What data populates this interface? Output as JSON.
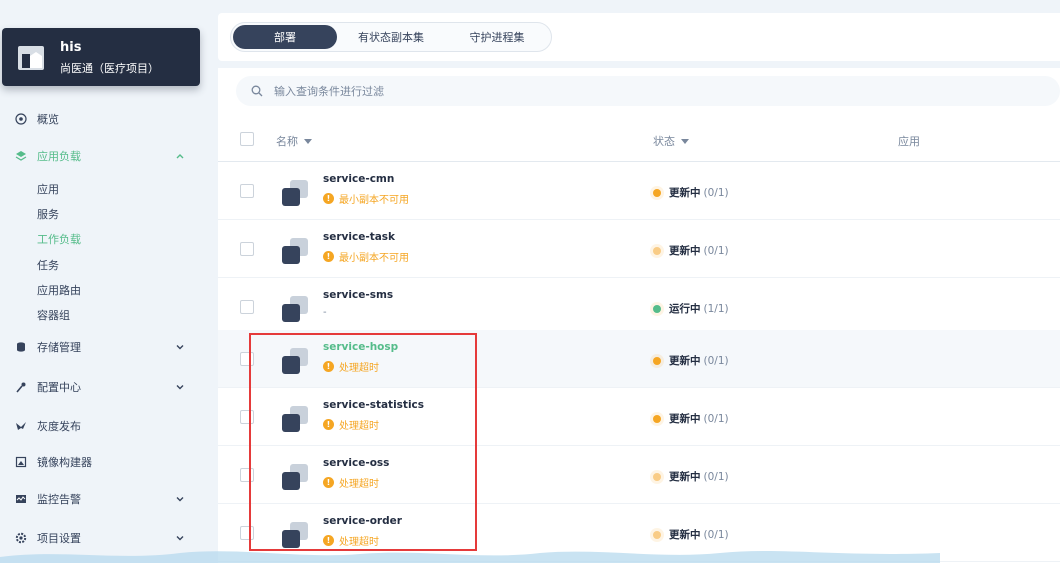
{
  "project": {
    "name": "his",
    "description": "尚医通（医疗项目）"
  },
  "nav": {
    "overview": "概览",
    "app_workloads": "应用负载",
    "sub": [
      "应用",
      "服务",
      "工作负载",
      "任务",
      "应用路由",
      "容器组"
    ],
    "storage": "存储管理",
    "config": "配置中心",
    "grayscale": "灰度发布",
    "image_builder": "镜像构建器",
    "monitoring": "监控告警",
    "project_settings": "项目设置"
  },
  "tabs": [
    "部署",
    "有状态副本集",
    "守护进程集"
  ],
  "search": {
    "placeholder": "输入查询条件进行过滤"
  },
  "table": {
    "headers": {
      "name": "名称",
      "status": "状态",
      "app": "应用"
    },
    "rows": [
      {
        "name": "service-cmn",
        "sub": "最小副本不可用",
        "status": "更新中",
        "count": "(0/1)",
        "dot": "#f5a623"
      },
      {
        "name": "service-task",
        "sub": "最小副本不可用",
        "status": "更新中",
        "count": "(0/1)",
        "dot": "#f9cc86"
      },
      {
        "name": "service-sms",
        "sub": "-",
        "status": "运行中",
        "count": "(1/1)",
        "dot": "#55bc8a"
      },
      {
        "name": "service-hosp",
        "sub": "处理超时",
        "status": "更新中",
        "count": "(0/1)",
        "dot": "#f5a623"
      },
      {
        "name": "service-statistics",
        "sub": "处理超时",
        "status": "更新中",
        "count": "(0/1)",
        "dot": "#f5a623"
      },
      {
        "name": "service-oss",
        "sub": "处理超时",
        "status": "更新中",
        "count": "(0/1)",
        "dot": "#f9cc86"
      },
      {
        "name": "service-order",
        "sub": "处理超时",
        "status": "更新中",
        "count": "(0/1)",
        "dot": "#f9cc86"
      }
    ]
  },
  "colors": {
    "accent": "#55bc8a",
    "warning": "#f5a623",
    "dark": "#242e42",
    "highlight": "#e53a3a"
  }
}
